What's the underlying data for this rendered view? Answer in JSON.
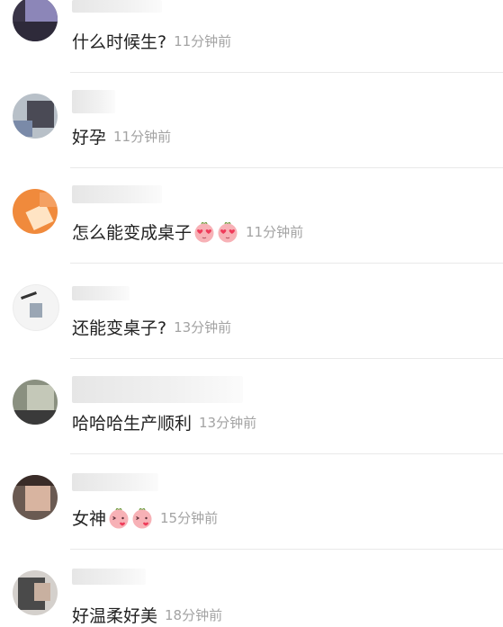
{
  "comments": [
    {
      "text": "什么时候生?",
      "time": "11分钟前",
      "emoji_icons": []
    },
    {
      "text": "好孕",
      "time": "11分钟前",
      "emoji_icons": []
    },
    {
      "text": "怎么能变成桌子",
      "time": "11分钟前",
      "emoji_icons": [
        "heart-eyes-face-icon",
        "heart-eyes-face-icon"
      ]
    },
    {
      "text": "还能变桌子?",
      "time": "13分钟前",
      "emoji_icons": []
    },
    {
      "text": "哈哈哈生产顺利",
      "time": "13分钟前",
      "emoji_icons": []
    },
    {
      "text": "女神",
      "time": "15分钟前",
      "emoji_icons": [
        "kiss-face-icon",
        "kiss-face-icon"
      ]
    },
    {
      "text": "好温柔好美",
      "time": "18分钟前",
      "emoji_icons": []
    }
  ],
  "colors": {
    "text": "#222222",
    "time": "#a3a3a3",
    "divider": "#e9e9e9",
    "emoji_face": "#f7b1b6",
    "emoji_heart": "#ef3b5a"
  }
}
